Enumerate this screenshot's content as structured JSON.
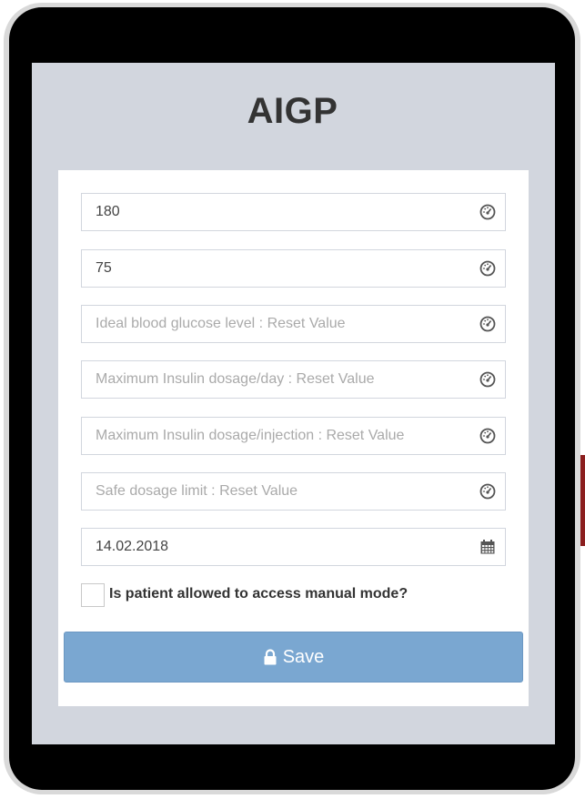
{
  "app": {
    "title": "AIGP"
  },
  "form": {
    "fields": [
      {
        "value": "180",
        "placeholder": "",
        "icon": "dashboard-icon"
      },
      {
        "value": "75",
        "placeholder": "",
        "icon": "dashboard-icon"
      },
      {
        "value": "",
        "placeholder": "Ideal blood glucose level : Reset Value",
        "icon": "dashboard-icon"
      },
      {
        "value": "",
        "placeholder": "Maximum Insulin dosage/day : Reset Value",
        "icon": "dashboard-icon"
      },
      {
        "value": "",
        "placeholder": "Maximum Insulin dosage/injection : Reset Value",
        "icon": "dashboard-icon"
      },
      {
        "value": "",
        "placeholder": "Safe dosage limit : Reset Value",
        "icon": "dashboard-icon"
      },
      {
        "value": "14.02.2018",
        "placeholder": "",
        "icon": "calendar-icon"
      }
    ],
    "manual_mode": {
      "label": "Is patient allowed to access manual mode?",
      "checked": false
    },
    "save_label": "Save"
  },
  "colors": {
    "screen_bg": "#d2d6de",
    "button_bg": "#7aa7d1",
    "title_color": "#333333"
  }
}
